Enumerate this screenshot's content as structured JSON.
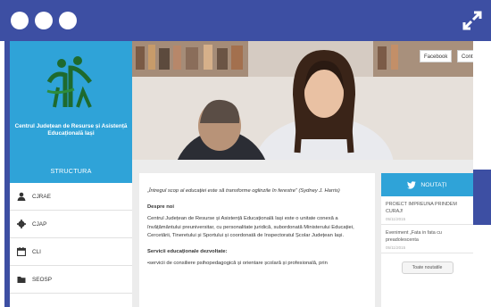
{
  "window": {
    "controls": [
      "dot",
      "dot",
      "dot"
    ],
    "expand_icon": "expand-arrows-icon",
    "accent_color": "#3d4fa3"
  },
  "logo": {
    "text": "Centrul Județean de Resurse și Asistență Educațională Iași",
    "icon": "children-figures-logo"
  },
  "hero": {
    "social": [
      "Facebook",
      "Cont"
    ]
  },
  "sidebar": {
    "title": "STRUCTURA",
    "items": [
      {
        "label": "CJRAE",
        "icon": "user-icon"
      },
      {
        "label": "CJAP",
        "icon": "gear-icon"
      },
      {
        "label": "CLI",
        "icon": "calendar-icon"
      },
      {
        "label": "SEOSP",
        "icon": "folder-icon"
      }
    ]
  },
  "main": {
    "quote": "„Întregul scop al educației este să transforme oglinzile în ferestre” (Sydney J. Harris)",
    "about_title": "Despre noi",
    "about_text": "Centrul Județean de Resurse și Asistență Educațională Iași este o unitate conexă a învățământului preuniversitar, cu personalitate juridică, subordonată Ministerului Educației, Cercetării, Tineretului și Sportului și coordonată de Inspectoratul Școlar Județean Iași.",
    "services_title": "Servicii educaționale dezvoltate:",
    "services_text": "•servicii de consiliere psihopedagogică și orientare școlară și profesională, prin"
  },
  "news": {
    "title": "NOUTAȚI",
    "icon": "twitter-bird-icon",
    "items": [
      {
        "title": "PROIECT IMPREUNA PRINDEM CURAJ!",
        "date": "05/11/2015"
      },
      {
        "title": "Eveniment „Fata in fata cu preadolescenta",
        "date": "05/11/2015"
      }
    ],
    "button": "Toate noutatile"
  },
  "colors": {
    "brand_blue": "#2fa3d8",
    "frame_blue": "#3d4fa3",
    "background": "#ececec"
  }
}
